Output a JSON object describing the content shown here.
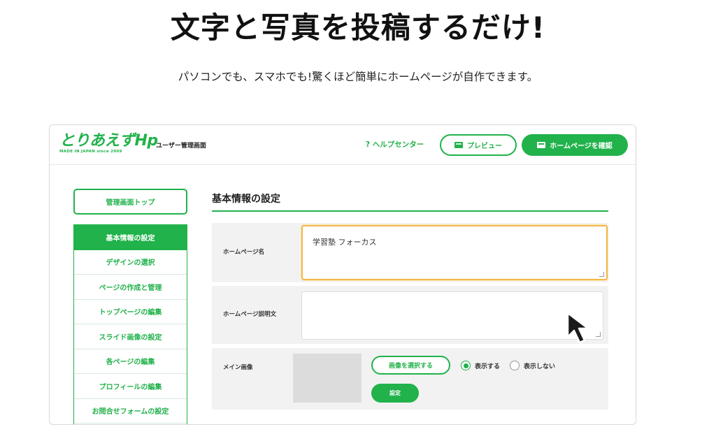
{
  "headline": "文字と写真を投稿するだけ!",
  "subheadline": "パソコンでも、スマホでも!驚くほど簡単にホームページが自作できます。",
  "app": {
    "logo_text": "とりあえずHp",
    "logo_tagline": "MADE IN JAPAN since 2009",
    "section_title": "ユーザー管理画面",
    "help_label": "? ヘルプセンター",
    "preview_label": "プレビュー",
    "view_site_label": "ホームページを確認"
  },
  "sidebar": {
    "top_button": "管理画面トップ",
    "items": [
      {
        "label": "基本情報の設定",
        "active": true
      },
      {
        "label": "デザインの選択",
        "active": false
      },
      {
        "label": "ページの作成と管理",
        "active": false
      },
      {
        "label": "トップページの編集",
        "active": false
      },
      {
        "label": "スライド画像の設定",
        "active": false
      },
      {
        "label": "各ページの編集",
        "active": false
      },
      {
        "label": "プロフィールの編集",
        "active": false
      },
      {
        "label": "お問合せフォームの設定",
        "active": false
      }
    ]
  },
  "main": {
    "title": "基本情報の設定",
    "fields": {
      "site_name": {
        "label": "ホームページ名",
        "value": "学習塾 フォーカス"
      },
      "site_description": {
        "label": "ホームページ説明文",
        "value": ""
      },
      "main_image": {
        "label": "メイン画像",
        "select_button": "画像を選択する",
        "show_label": "表示する",
        "hide_label": "表示しない",
        "selected": "show",
        "set_button": "設定"
      }
    }
  },
  "colors": {
    "brand_green": "#21b24b",
    "focus_orange": "#f2b84b",
    "row_background": "#f2f2f2"
  }
}
